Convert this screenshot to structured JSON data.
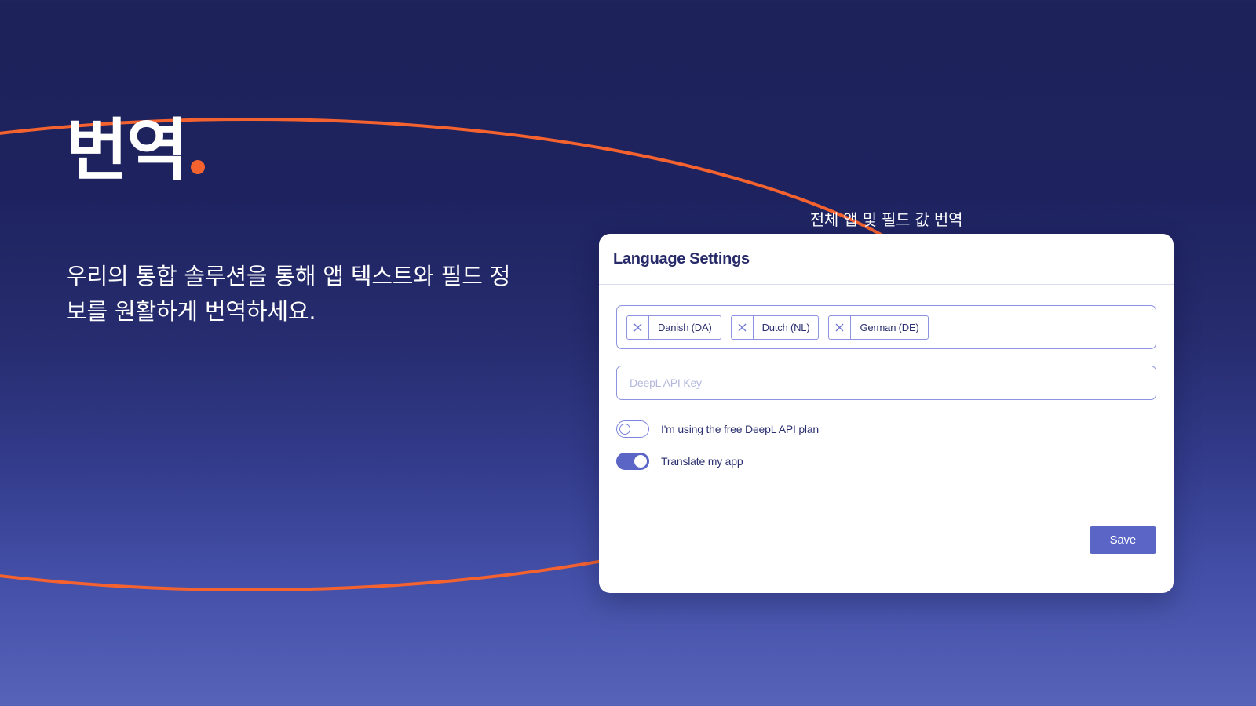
{
  "colors": {
    "bg_top": "#1D2259",
    "bg_bottom": "#5663B8",
    "accent_orange": "#F4622F",
    "accent_purple": "#5B65C6",
    "card_bg": "#FFFFFF",
    "border_purple": "#8D93E0",
    "title_navy": "#272A68"
  },
  "hero": {
    "logo_word": "번역",
    "logo_dot_icon": "orange-dot-icon",
    "description": "우리의 통합 솔루션을 통해 앱 텍스트와 필드 정보를 원활하게 번역하세요."
  },
  "decoration": {
    "arc_icon": "orange-arc-curve"
  },
  "card": {
    "caption": "전체 앱 및 필드 값 번역",
    "title": "Language Settings",
    "languages": [
      {
        "label": "Danish (DA)",
        "remove_icon": "close-x-icon"
      },
      {
        "label": "Dutch (NL)",
        "remove_icon": "close-x-icon"
      },
      {
        "label": "German (DE)",
        "remove_icon": "close-x-icon"
      }
    ],
    "api_key": {
      "placeholder": "DeepL API Key",
      "value": ""
    },
    "toggles": [
      {
        "label": "I'm using the free DeepL API plan",
        "state": "off"
      },
      {
        "label": "Translate my app",
        "state": "on"
      }
    ],
    "save_label": "Save"
  }
}
